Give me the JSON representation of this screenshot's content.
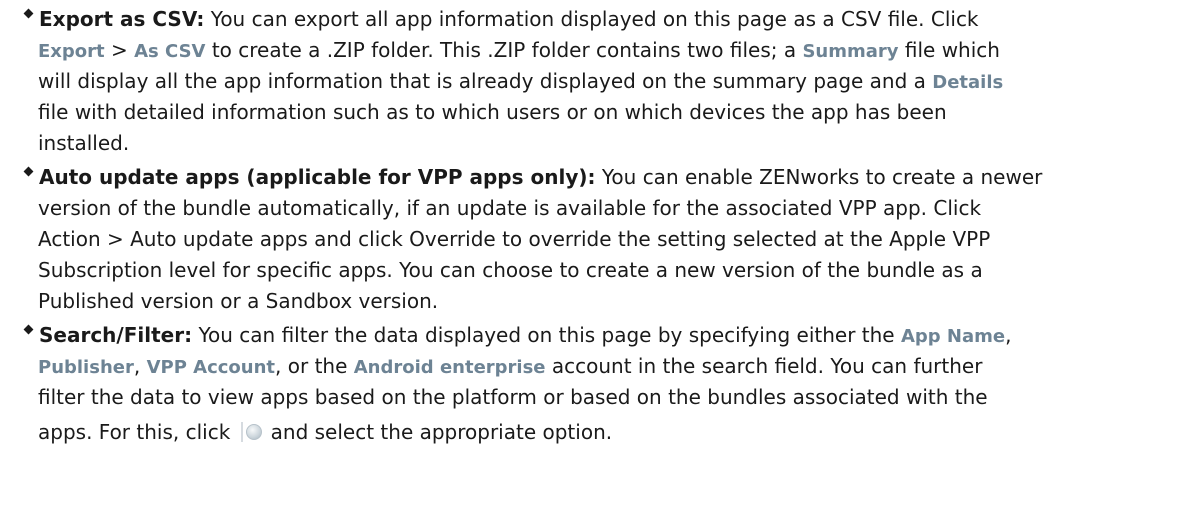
{
  "items": [
    {
      "term": "Export as CSV:",
      "lines": [
        [
          {
            "t": " You can export all app information displayed on this page as a CSV file. Click"
          }
        ],
        [
          {
            "t": "Export",
            "ui": true
          },
          {
            "t": " > "
          },
          {
            "t": "As CSV",
            "ui": true
          },
          {
            "t": " to create a .ZIP folder. This .ZIP folder contains two files; a "
          },
          {
            "t": "Summary",
            "ui": true
          },
          {
            "t": " file which"
          }
        ],
        [
          {
            "t": "will display all the app information that is already displayed on the summary page and a "
          },
          {
            "t": "Details",
            "ui": true
          }
        ],
        [
          {
            "t": "file with detailed information such as to which users or on which devices the app has been"
          }
        ],
        [
          {
            "t": "installed."
          }
        ]
      ]
    },
    {
      "term": "Auto update apps (applicable for VPP apps only):",
      "lines": [
        [
          {
            "t": "  You can enable ZENworks to create a newer"
          }
        ],
        [
          {
            "t": "version of the bundle automatically, if an update is available for the associated VPP app. Click"
          }
        ],
        [
          {
            "t": "Action > Auto update apps and click Override to override the setting selected at the Apple VPP"
          }
        ],
        [
          {
            "t": "Subscription level for specific apps. You can choose to create a new version of the bundle as a"
          }
        ],
        [
          {
            "t": "Published version or a Sandbox version."
          }
        ]
      ]
    },
    {
      "term": "Search/Filter:",
      "lines": [
        [
          {
            "t": " You can filter the data displayed on this page by specifying either the "
          },
          {
            "t": "App Name",
            "ui": true
          },
          {
            "t": ","
          }
        ],
        [
          {
            "t": "Publisher",
            "ui": true
          },
          {
            "t": ", "
          },
          {
            "t": "VPP Account",
            "ui": true
          },
          {
            "t": ", or the "
          },
          {
            "t": "Android enterprise",
            "ui": true
          },
          {
            "t": " account in the search field. You can further"
          }
        ],
        [
          {
            "t": "filter the data to view apps based on the platform or based on the bundles associated with the"
          }
        ],
        [
          {
            "t": "apps. For this, click "
          },
          {
            "icon": "filter-icon"
          },
          {
            "t": "and select the appropriate option."
          }
        ]
      ]
    }
  ]
}
